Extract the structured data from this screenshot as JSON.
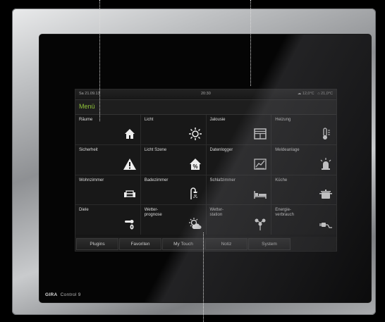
{
  "device": {
    "brand": "GIRA",
    "model": "Control 9"
  },
  "status": {
    "date": "Sa 21.09.13",
    "time": "20:30",
    "outdoor_temp": "12,0°C",
    "indoor_temp": "21,0°C"
  },
  "menu": {
    "title": "Menü",
    "tiles": [
      {
        "label": "Räume",
        "icon": "house-icon"
      },
      {
        "label": "Licht",
        "icon": "sun-icon"
      },
      {
        "label": "Jalousie",
        "icon": "blinds-icon"
      },
      {
        "label": "Heizung",
        "icon": "thermometer-icon"
      },
      {
        "label": "Sicherheit",
        "icon": "warning-icon"
      },
      {
        "label": "Licht Szene",
        "icon": "house-percent-icon"
      },
      {
        "label": "Datenlogger",
        "icon": "chart-icon"
      },
      {
        "label": "Meldeanlage",
        "icon": "alarm-light-icon"
      },
      {
        "label": "Wohnzimmer",
        "icon": "sofa-icon"
      },
      {
        "label": "Badezimmer",
        "icon": "shower-icon"
      },
      {
        "label": "Schlafzimmer",
        "icon": "bed-icon"
      },
      {
        "label": "Küche",
        "icon": "pot-icon"
      },
      {
        "label": "Diele",
        "icon": "door-handle-icon"
      },
      {
        "label": "Wetter-\nprognose",
        "icon": "weather-icon"
      },
      {
        "label": "Wetter-\nstation",
        "icon": "anemometer-icon"
      },
      {
        "label": "Energie-\nverbrauch",
        "icon": "plug-icon"
      }
    ]
  },
  "tabs": [
    "Plugins",
    "Favoriten",
    "My Touch",
    "Notiz",
    "System"
  ]
}
